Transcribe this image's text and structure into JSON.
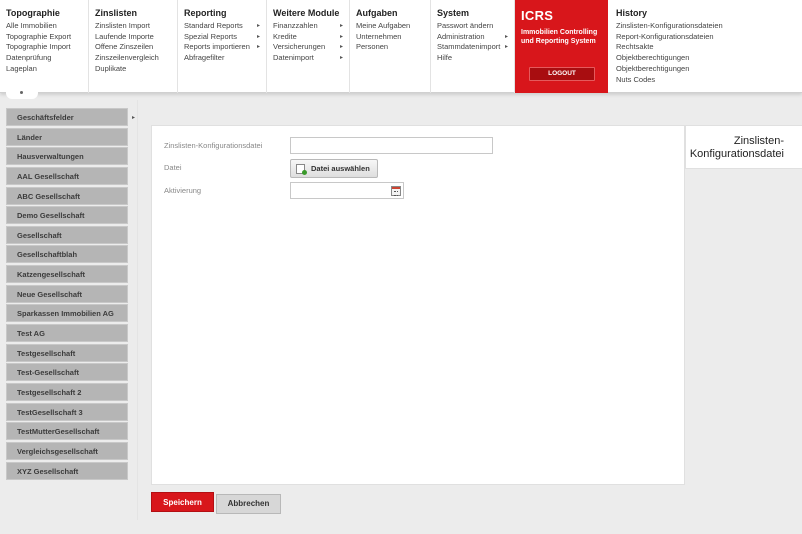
{
  "menu": [
    {
      "title": "Topographie",
      "items": [
        {
          "label": "Alle Immobilien"
        },
        {
          "label": "Topographie Export"
        },
        {
          "label": "Topographie Import"
        },
        {
          "label": "Datenprüfung"
        },
        {
          "label": "Lageplan"
        }
      ]
    },
    {
      "title": "Zinslisten",
      "items": [
        {
          "label": "Zinslisten Import"
        },
        {
          "label": "Laufende Importe"
        },
        {
          "label": "Offene Zinszeilen"
        },
        {
          "label": "Zinszeilenvergleich"
        },
        {
          "label": "Duplikate"
        }
      ]
    },
    {
      "title": "Reporting",
      "items": [
        {
          "label": "Standard Reports",
          "arrow": "▸"
        },
        {
          "label": "Spezial Reports",
          "arrow": "▸"
        },
        {
          "label": "Reports importieren",
          "arrow": "▸"
        },
        {
          "label": "Abfragefilter"
        }
      ]
    },
    {
      "title": "Weitere Module",
      "items": [
        {
          "label": "Finanzzahlen",
          "arrow": "▸"
        },
        {
          "label": "Kredite",
          "arrow": "▸"
        },
        {
          "label": "Versicherungen",
          "arrow": "▸"
        },
        {
          "label": "Datenimport",
          "arrow": "▸"
        }
      ]
    },
    {
      "title": "Aufgaben",
      "items": [
        {
          "label": "Meine Aufgaben"
        },
        {
          "label": "Unternehmen"
        },
        {
          "label": "Personen"
        }
      ]
    },
    {
      "title": "System",
      "items": [
        {
          "label": "Passwort ändern"
        },
        {
          "label": "Administration",
          "arrow": "▸"
        },
        {
          "label": "Stammdatenimport",
          "arrow": "▸"
        },
        {
          "label": "Hilfe"
        }
      ]
    }
  ],
  "icrs": {
    "brand": "ICRS",
    "subtitle": "Immobilien Controlling und Reporting System",
    "logout": "LOGOUT",
    "color": "#d8161b"
  },
  "history": {
    "title": "History",
    "items": [
      {
        "label": "Zinslisten-Konfigurationsdateien"
      },
      {
        "label": "Report-Konfigurationsdateien"
      },
      {
        "label": "Rechtsakte"
      },
      {
        "label": "Objektberechtigungen"
      },
      {
        "label": "Objektberechtigungen"
      },
      {
        "label": "Nuts Codes"
      }
    ]
  },
  "sidebar": {
    "arrow": "▸",
    "items": [
      {
        "label": "Geschäftsfelder"
      },
      {
        "label": "Länder"
      },
      {
        "label": "Hausverwaltungen"
      },
      {
        "label": "AAL Gesellschaft"
      },
      {
        "label": "ABC Gesellschaft"
      },
      {
        "label": "Demo Gesellschaft"
      },
      {
        "label": "Gesellschaft"
      },
      {
        "label": "Gesellschaftblah"
      },
      {
        "label": "Katzengesellschaft"
      },
      {
        "label": "Neue Gesellschaft"
      },
      {
        "label": "Sparkassen Immobilien AG"
      },
      {
        "label": "Test AG"
      },
      {
        "label": "Testgesellschaft"
      },
      {
        "label": "Test-Gesellschaft"
      },
      {
        "label": "Testgesellschaft 2"
      },
      {
        "label": "TestGesellschaft 3"
      },
      {
        "label": "TestMutterGesellschaft"
      },
      {
        "label": "Vergleichsgesellschaft"
      },
      {
        "label": "XYZ Gesellschaft"
      }
    ]
  },
  "form": {
    "name_label": "Zinslisten-Konfigurationsdatei",
    "name_value": "",
    "file_label": "Datei",
    "file_button": "Datei auswählen",
    "activation_label": "Aktivierung",
    "activation_value": ""
  },
  "panel_title": "Zinslisten-Konfigurationsdatei",
  "buttons": {
    "save": "Speichern",
    "cancel": "Abbrechen"
  }
}
